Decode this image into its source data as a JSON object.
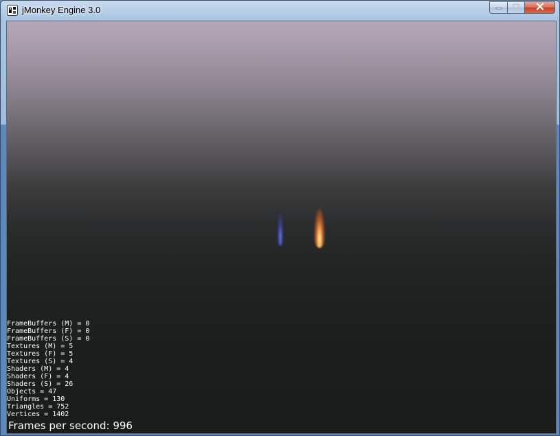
{
  "window": {
    "title": "jMonkey Engine 3.0",
    "app_icon": "jmonkey-logo-icon",
    "caption_buttons": {
      "minimize_icon": "minimize-icon",
      "maximize_icon": "maximize-icon",
      "close_icon": "close-icon"
    }
  },
  "scene": {
    "flames": [
      {
        "name": "blue-flame",
        "color": "#6a7cff"
      },
      {
        "name": "orange-flame",
        "color": "#ffb25a"
      }
    ]
  },
  "stats": {
    "lines": [
      "FrameBuffers (M) = 0",
      "FrameBuffers (F) = 0",
      "FrameBuffers (S) = 0",
      "Textures (M) = 5",
      "Textures (F) = 5",
      "Textures (S) = 4",
      "Shaders (M) = 4",
      "Shaders (F) = 4",
      "Shaders (S) = 26",
      "Objects = 47",
      "Uniforms = 130",
      "Triangles = 752",
      "Vertices = 1402"
    ],
    "fps_label": "Frames per second: 996"
  }
}
